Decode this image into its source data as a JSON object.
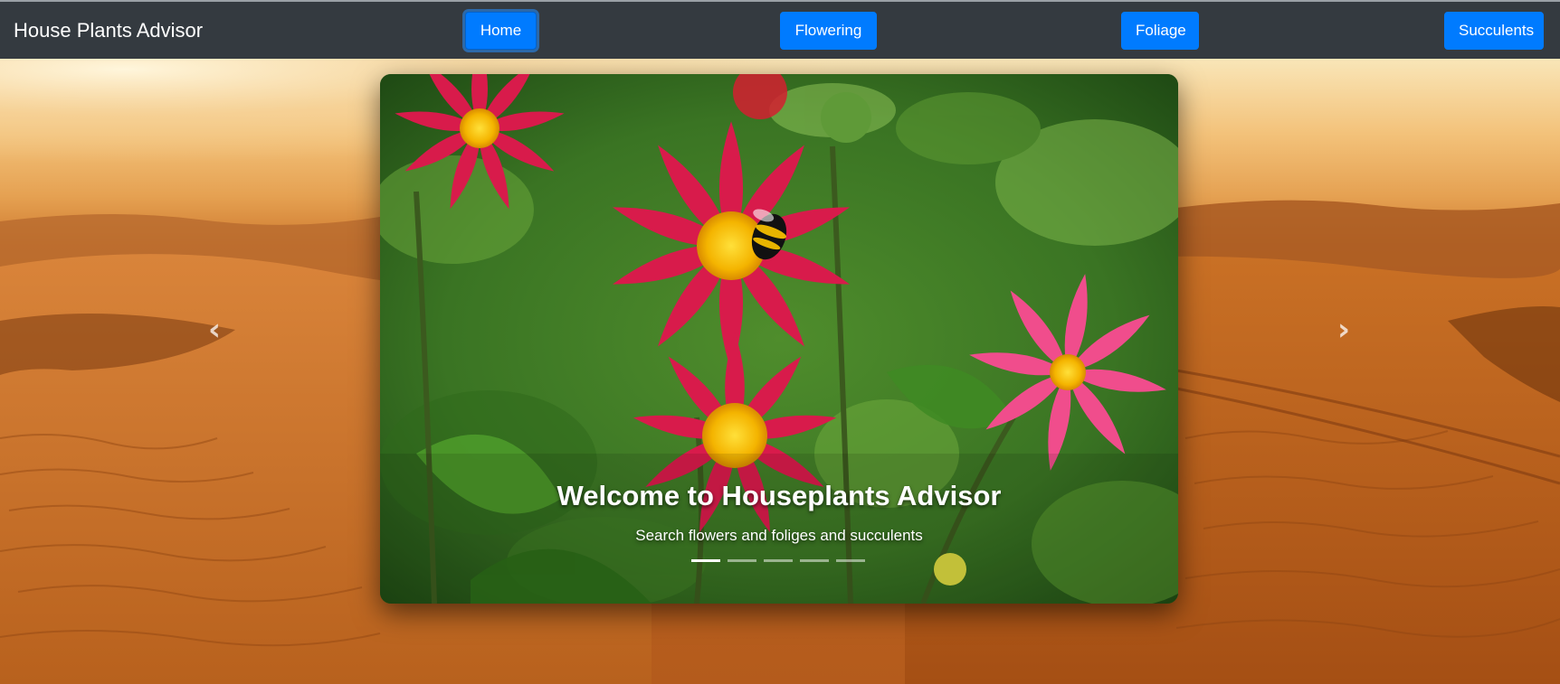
{
  "navbar": {
    "brand": "House Plants Advisor",
    "links": [
      {
        "label": "Home",
        "active": true
      },
      {
        "label": "Flowering",
        "active": false
      },
      {
        "label": "Foliage",
        "active": false
      },
      {
        "label": "Succulents",
        "active": false
      }
    ]
  },
  "carousel": {
    "caption_title": "Welcome to Houseplants Advisor",
    "caption_subtitle": "Search flowers and foliges and succulents",
    "slide_count": 5,
    "active_slide": 1,
    "prev_icon": "chevron-left-icon",
    "next_icon": "chevron-right-icon"
  },
  "colors": {
    "navbar_bg": "#343a40",
    "button_primary": "#007bff",
    "button_text": "#ffffff"
  }
}
